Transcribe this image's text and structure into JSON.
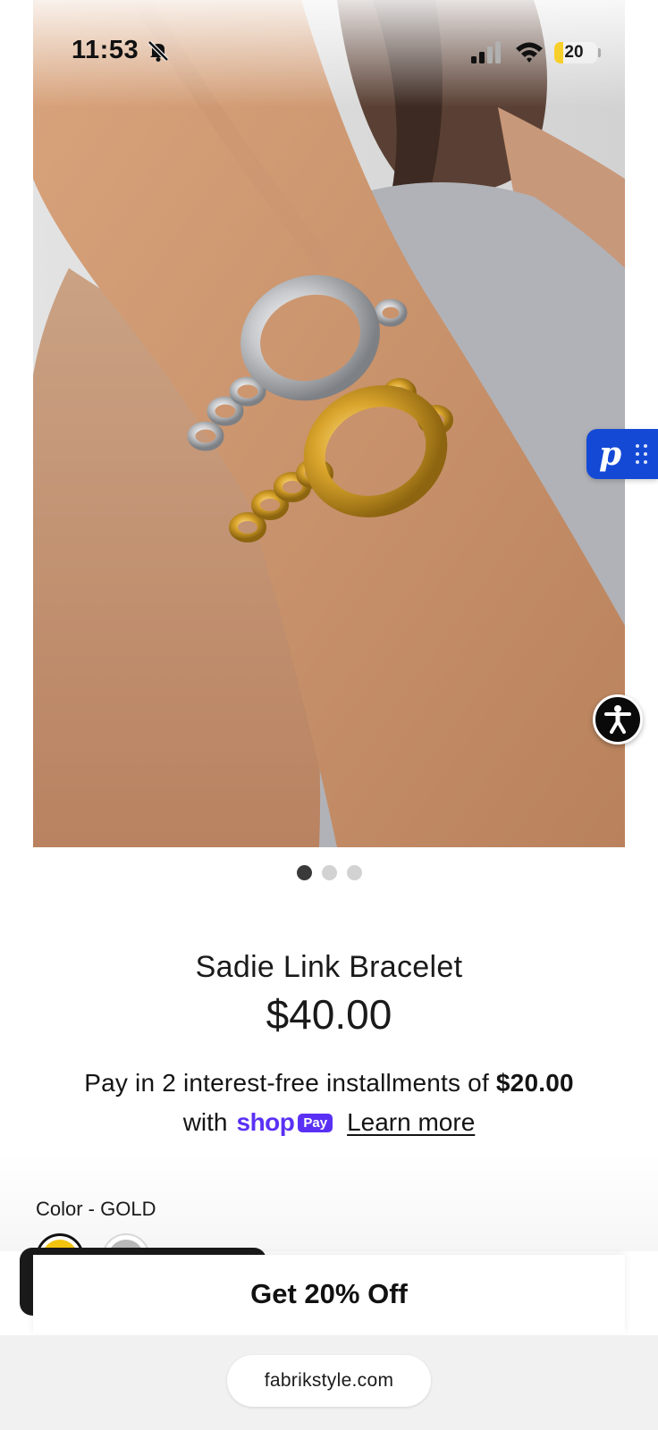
{
  "status_bar": {
    "time": "11:53",
    "battery_level": "20",
    "battery_fraction": 0.2,
    "icons": [
      "bell-off-icon",
      "signal-icon",
      "wifi-icon",
      "battery-icon"
    ]
  },
  "gallery": {
    "image_alt": "Sadie Link Bracelet - gold and silver bracelets on wrist",
    "slide_count": 3,
    "active_slide": 1
  },
  "product": {
    "title": "Sadie Link Bracelet",
    "price": "$40.00"
  },
  "installments": {
    "line1_prefix": "Pay in 2 interest-free installments of ",
    "amount": "$20.00",
    "with": "with",
    "shop_word": "shop",
    "pay_badge": "Pay",
    "learn_more": "Learn more"
  },
  "variant": {
    "color_label": "Color - GOLD",
    "swatches": [
      {
        "name": "Gold",
        "color": "#f2c410",
        "selected": true
      },
      {
        "name": "Silver",
        "color": "#b8b8b8",
        "selected": false
      }
    ]
  },
  "widgets": {
    "p_letter": "p",
    "accessibility_icon": "accessibility-icon"
  },
  "offer": {
    "label": "Get 20% Off"
  },
  "browser": {
    "url": "fabrikstyle.com"
  },
  "colors": {
    "shop_pay_purple": "#5a31f4",
    "widget_blue": "#1449d6",
    "gold": "#f2c410",
    "silver": "#b8b8b8"
  }
}
